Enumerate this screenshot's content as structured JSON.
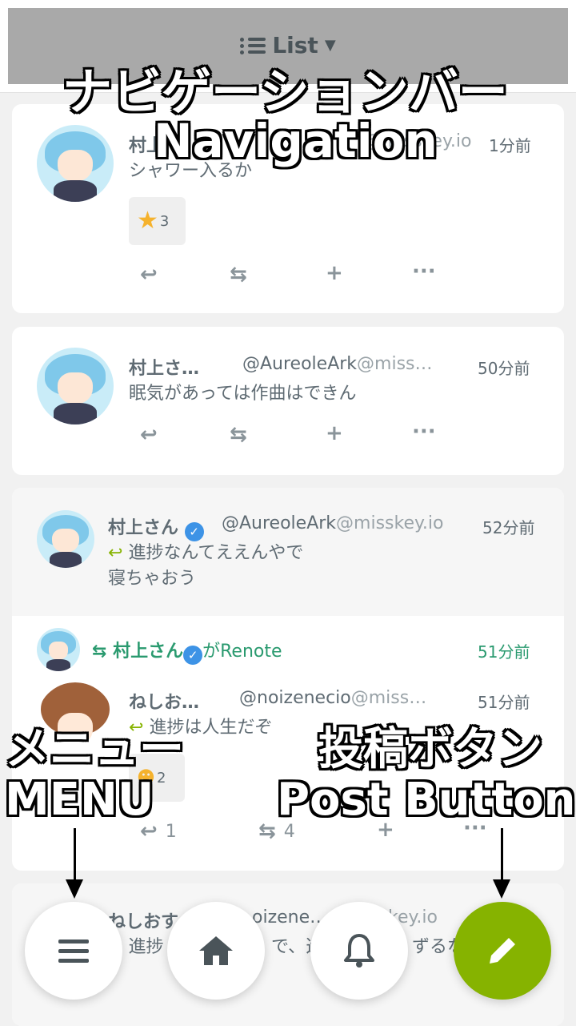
{
  "header": {
    "title": "List",
    "chevron": "chevron-down-icon"
  },
  "notes": [
    {
      "name": "村上さん",
      "name_short": "村上",
      "handle_user": "@AureoleArk",
      "handle_host": "@misskey.io",
      "time": "1分前",
      "text": "シャワー入るか",
      "reaction_count": "3"
    },
    {
      "name_short": "村上さ…",
      "handle_user": "@AureoleArk",
      "handle_host": "@miss…",
      "time": "50分前",
      "text": "眠気があっては作曲はできん"
    },
    {
      "quote": {
        "name": "村上さん",
        "handle_user": "@AureoleArk",
        "handle_host": "@misskey.io",
        "time": "52分前",
        "text_line1": "進捗なんてええんやで",
        "text_line2": "寝ちゃおう"
      },
      "renote": {
        "by": "村上さん",
        "suffix": "がRenote",
        "time": "51分前"
      },
      "inner": {
        "name_short": "ねしお…",
        "handle_user": "@noizenecio",
        "handle_host": "@miss…",
        "time": "51分前",
        "text": "進捗は人生だぞ",
        "reaction_count": "2",
        "reply_count": "1",
        "renote_count": "4"
      }
    },
    {
      "name_short": "ねしおす",
      "handle_tail": "oizenecio",
      "handle_host_tail": "key.io",
      "text": "進捗",
      "text_tail": "で、進",
      "text_end": "ずるな"
    }
  ],
  "overlay": {
    "nav_jp": "ナビゲーションバー",
    "nav_en": "Navigation",
    "menu_jp": "メニュー",
    "menu_en": "MENU",
    "post_jp": "投稿ボタン",
    "post_en": "Post Button"
  },
  "bottom_bar": [
    "menu-icon",
    "home-icon",
    "bell-icon",
    "pencil-icon"
  ],
  "colors": {
    "accent": "#86b300",
    "renote": "#2a9a6f",
    "verified": "#3d93e6"
  }
}
